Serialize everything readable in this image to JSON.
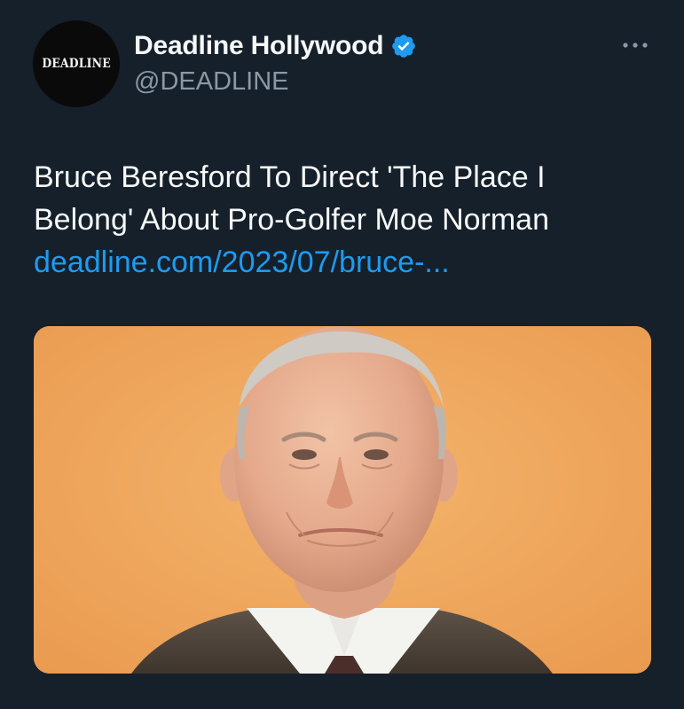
{
  "account": {
    "display_name": "Deadline Hollywood",
    "handle": "@DEADLINE",
    "avatar_wordmark": "DEADLINE",
    "verified": true
  },
  "tweet": {
    "text_line_1": "Bruce Beresford To Direct 'The Place I",
    "text_line_2": "Belong' About Pro-Golfer Moe Norman",
    "link_text": "deadline.com/2023/07/bruce-..."
  },
  "icons": {
    "verified": "verified-badge-icon",
    "more": "more-options-icon"
  },
  "colors": {
    "background": "#15202b",
    "primary_text": "#f7f9f9",
    "secondary_text": "#8b98a5",
    "link": "#1d9bf0",
    "verified": "#1d9bf0",
    "photo_backdrop": "#f0a85e"
  }
}
